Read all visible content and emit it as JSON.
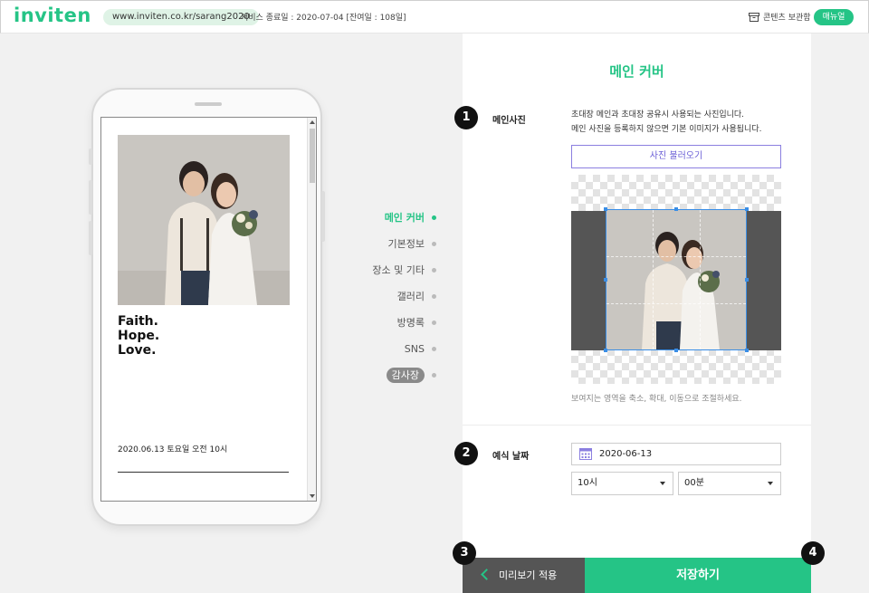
{
  "header": {
    "logo": "inviten",
    "url": "www.inviten.co.kr/sarang2020",
    "service_info": "서비스 종료일 : 2020-07-04 [잔여일 : 108일]",
    "storage_label": "콘텐츠 보관함",
    "manual_label": "매뉴얼"
  },
  "preview": {
    "slogan": [
      "Faith.",
      "Hope.",
      "Love."
    ],
    "date_text": "2020.06.13 토요일 오전 10시"
  },
  "steps": [
    {
      "label": "메인 커버",
      "active": true
    },
    {
      "label": "기본정보"
    },
    {
      "label": "장소 및 기타"
    },
    {
      "label": "갤러리"
    },
    {
      "label": "방명록"
    },
    {
      "label": "SNS"
    },
    {
      "label": "감사장",
      "pill": true
    }
  ],
  "panel": {
    "title": "메인 커버",
    "main_photo": {
      "badge": "1",
      "label": "메인사진",
      "desc_line1": "초대장 메인과 초대장 공유시 사용되는 사진입니다.",
      "desc_line2": "메인 사진을 등록하지 않으면 기본 이미지가 사용됩니다.",
      "load_button": "사진 불러오기",
      "hint": "보여지는 영역을 축소, 확대, 이동으로 조절하세요."
    },
    "wedding_date": {
      "badge": "2",
      "label": "예식 날짜",
      "date_value": "2020-06-13",
      "hour_value": "10시",
      "minute_value": "00분"
    }
  },
  "footer": {
    "badge_preview": "3",
    "badge_save": "4",
    "preview_label": "미리보기 적용",
    "save_label": "저장하기"
  },
  "colors": {
    "accent": "#25c486",
    "dark_button": "#555555",
    "load_button_border": "#8b7fe0"
  }
}
